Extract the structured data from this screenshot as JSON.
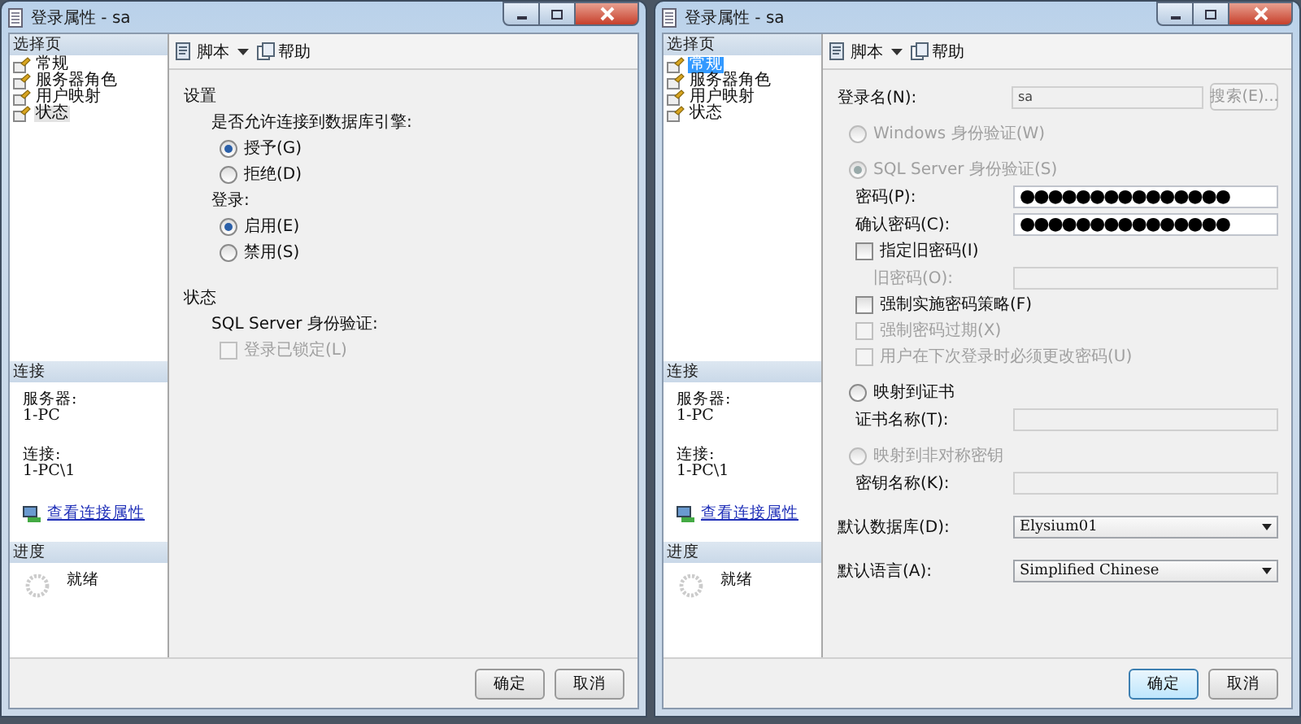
{
  "windows": [
    {
      "title": "登录属性 - sa",
      "focused": false,
      "pages_header": "选择页",
      "pages": [
        {
          "label": "常规",
          "selected": false
        },
        {
          "label": "服务器角色",
          "selected": false
        },
        {
          "label": "用户映射",
          "selected": false
        },
        {
          "label": "状态",
          "selected": true
        }
      ],
      "toolbar": {
        "script": "脚本",
        "help": "帮助"
      },
      "content": [
        {
          "kind": "heading",
          "label": "设置",
          "children": [
            {
              "kind": "label",
              "label": "是否允许连接到数据库引擎:",
              "children": [
                {
                  "kind": "radio",
                  "label": "授予(G)",
                  "selected": true,
                  "disabled": false
                },
                {
                  "kind": "radio",
                  "label": "拒绝(D)",
                  "selected": false,
                  "disabled": false
                }
              ]
            },
            {
              "kind": "label",
              "label": "登录:",
              "children": [
                {
                  "kind": "radio",
                  "label": "启用(E)",
                  "selected": true,
                  "disabled": false
                },
                {
                  "kind": "radio",
                  "label": "禁用(S)",
                  "selected": false,
                  "disabled": false
                }
              ]
            }
          ]
        },
        {
          "kind": "heading",
          "label": "状态",
          "children": [
            {
              "kind": "label",
              "label": "SQL Server 身份验证:",
              "children": [
                {
                  "kind": "checkbox",
                  "label": "登录已锁定(L)",
                  "checked": false,
                  "disabled": true
                }
              ]
            }
          ]
        }
      ],
      "connection": {
        "header": "连接",
        "server_label": "服务器:",
        "server": "1-PC",
        "connection_label": "连接:",
        "connection": "1-PC\\1",
        "link": "查看连接属性"
      },
      "progress": {
        "header": "进度",
        "status": "就绪"
      },
      "buttons": [
        "确定",
        "取消"
      ]
    },
    {
      "title": "登录属性 - sa",
      "focused": true,
      "pages_header": "选择页",
      "pages": [
        {
          "label": "常规",
          "selected": true
        },
        {
          "label": "服务器角色",
          "selected": false
        },
        {
          "label": "用户映射",
          "selected": false
        },
        {
          "label": "状态",
          "selected": false
        }
      ],
      "toolbar": {
        "script": "脚本",
        "help": "帮助"
      },
      "content": [
        {
          "kind": "field",
          "label": "登录名(N):",
          "value": "sa",
          "disabled": true,
          "button": "搜索(E)..."
        },
        {
          "kind": "radio",
          "label": "Windows 身份验证(W)",
          "selected": false,
          "disabled": true
        },
        {
          "kind": "radio",
          "label": "SQL Server 身份验证(S)",
          "selected": true,
          "disabled": true,
          "children": [
            {
              "kind": "field",
              "label": "密码(P):",
              "value": "●●●●●●●●●●●●●●●",
              "disabled": false
            },
            {
              "kind": "field",
              "label": "确认密码(C):",
              "value": "●●●●●●●●●●●●●●●",
              "disabled": false
            },
            {
              "kind": "checkbox",
              "label": "指定旧密码(I)",
              "checked": false,
              "disabled": false,
              "children": [
                {
                  "kind": "field",
                  "label": "旧密码(O):",
                  "disabled": true
                }
              ]
            },
            {
              "kind": "checkbox",
              "label": "强制实施密码策略(F)",
              "checked": false,
              "disabled": false
            },
            {
              "kind": "checkbox",
              "label": "强制密码过期(X)",
              "checked": false,
              "disabled": true
            },
            {
              "kind": "checkbox",
              "label": "用户在下次登录时必须更改密码(U)",
              "checked": false,
              "disabled": true
            }
          ]
        },
        {
          "kind": "radio",
          "label": "映射到证书",
          "selected": false,
          "disabled": false,
          "children": [
            {
              "kind": "field",
              "label": "证书名称(T):",
              "disabled": true
            }
          ]
        },
        {
          "kind": "radio",
          "label": "映射到非对称密钥",
          "selected": false,
          "disabled": true,
          "children": [
            {
              "kind": "field",
              "label": "密钥名称(K):",
              "disabled": true
            }
          ]
        },
        {
          "kind": "select",
          "label": "默认数据库(D):",
          "value": "Elysium01"
        },
        {
          "kind": "select",
          "label": "默认语言(A):",
          "value": "Simplified Chinese"
        }
      ],
      "connection": {
        "header": "连接",
        "server_label": "服务器:",
        "server": "1-PC",
        "connection_label": "连接:",
        "connection": "1-PC\\1",
        "link": "查看连接属性"
      },
      "progress": {
        "header": "进度",
        "status": "就绪"
      },
      "buttons": [
        "确定",
        "取消"
      ]
    }
  ]
}
